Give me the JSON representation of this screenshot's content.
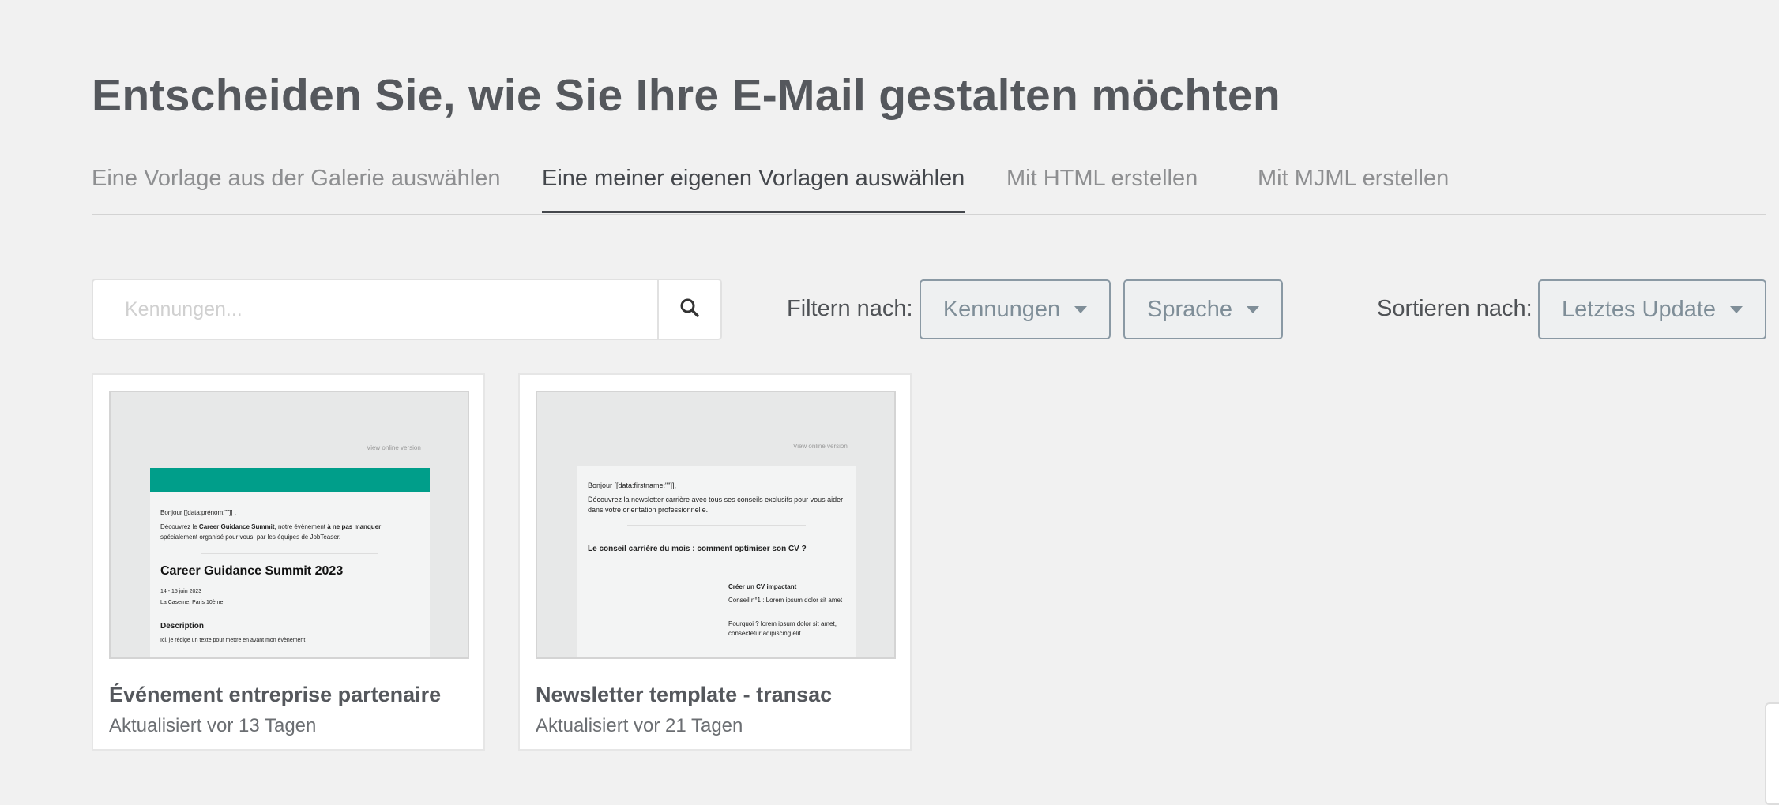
{
  "page": {
    "title": "Entscheiden Sie, wie Sie Ihre E-Mail gestalten möchten"
  },
  "tabs": [
    {
      "label": "Eine Vorlage aus der Galerie auswählen",
      "active": false
    },
    {
      "label": "Eine meiner eigenen Vorlagen auswählen",
      "active": true
    },
    {
      "label": "Mit HTML erstellen",
      "active": false
    },
    {
      "label": "Mit MJML erstellen",
      "active": false
    }
  ],
  "search": {
    "placeholder": "Kennungen...",
    "value": "",
    "icon": "search-icon"
  },
  "filter": {
    "label": "Filtern nach:",
    "dropdowns": [
      {
        "label": "Kennungen",
        "icon": "caret-down-icon"
      },
      {
        "label": "Sprache",
        "icon": "caret-down-icon"
      }
    ]
  },
  "sort": {
    "label": "Sortieren nach:",
    "value": "Letztes Update",
    "icon": "caret-down-icon"
  },
  "colors": {
    "accent": "#009e8a",
    "dropdown_border": "#8a99a4",
    "background": "#f1f1f1"
  },
  "templates": [
    {
      "title": "Événement entreprise partenaire",
      "meta": "Aktualisiert vor 13 Tagen",
      "preview": {
        "view_online": "View online version",
        "greeting": "Bonjour [[data:prénom:\"\"]] ,",
        "intro_1": "Découvrez le ",
        "intro_bold_1": "Career Guidance Summit",
        "intro_2": ", notre évènement ",
        "intro_bold_2": "à ne pas manquer",
        "intro_3": "spécialement organisé pour vous, par les équipes de JobTeaser.",
        "heading": "Career Guidance Summit 2023",
        "date": "14 - 15 juin 2023",
        "place": "La Caserne, Paris 10ème",
        "desc_title": "Description",
        "desc_text": "Ici, je rédige un texte pour mettre en avant mon évènement"
      }
    },
    {
      "title": "Newsletter template - transac",
      "meta": "Aktualisiert vor 21 Tagen",
      "preview": {
        "view_online": "View online version",
        "greeting": "Bonjour [[data:firstname:\"\"]],",
        "intro": "Découvrez la newsletter carrière avec tous ses conseils exclusifs pour vous aider dans votre orientation professionnelle.",
        "heading": "Le conseil carrière du mois : comment optimiser son CV ?",
        "sub_title": "Créer un CV impactant",
        "tip_1": "Conseil n°1 : Lorem ipsum dolor sit amet",
        "tip_2": "Pourquoi ? lorem ipsum dolor sit amet, consectetur adipiscing elit."
      }
    }
  ]
}
